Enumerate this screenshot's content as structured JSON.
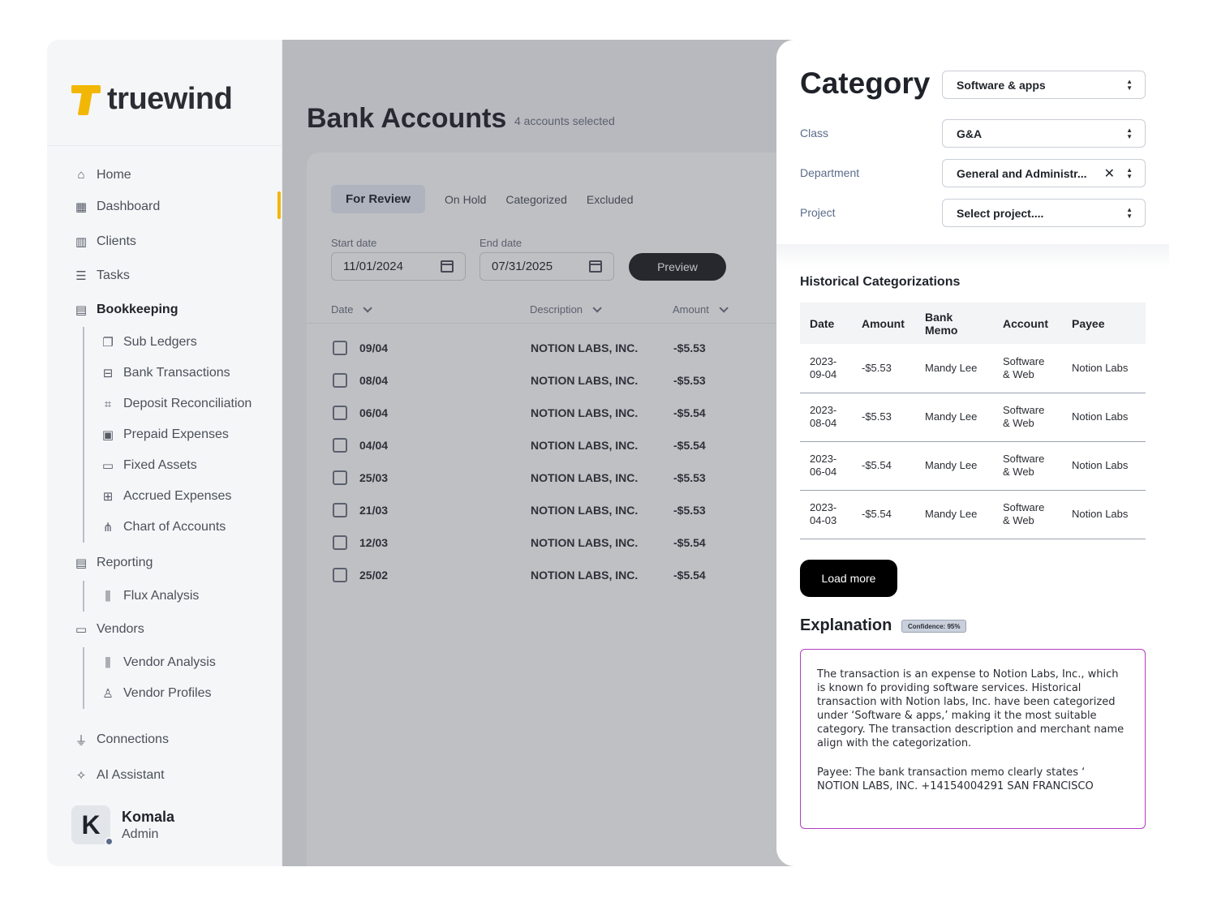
{
  "app": {
    "logo_text": "truewind",
    "brand_color": "#f2b705"
  },
  "sidebar": {
    "items": [
      {
        "label": "Home",
        "icon": "home-icon"
      },
      {
        "label": "Dashboard",
        "icon": "dashboard-icon"
      },
      {
        "label": "Clients",
        "icon": "building-icon"
      },
      {
        "label": "Tasks",
        "icon": "checklist-icon"
      },
      {
        "label": "Bookkeeping",
        "icon": "book-icon"
      },
      {
        "label": "Sub Ledgers",
        "icon": "copy-icon"
      },
      {
        "label": "Bank Transactions",
        "icon": "bank-icon"
      },
      {
        "label": "Deposit Reconciliation",
        "icon": "scan-icon"
      },
      {
        "label": "Prepaid Expenses",
        "icon": "clipboard-icon"
      },
      {
        "label": "Fixed Assets",
        "icon": "laptop-icon"
      },
      {
        "label": "Accrued Expenses",
        "icon": "plus-doc-icon"
      },
      {
        "label": "Chart of Accounts",
        "icon": "hierarchy-icon"
      },
      {
        "label": "Reporting",
        "icon": "report-icon"
      },
      {
        "label": "Flux Analysis",
        "icon": "bar-chart-icon"
      },
      {
        "label": "Vendors",
        "icon": "card-icon"
      },
      {
        "label": "Vendor Analysis",
        "icon": "bar-chart-icon"
      },
      {
        "label": "Vendor Profiles",
        "icon": "person-icon"
      },
      {
        "label": "Connections",
        "icon": "plug-icon"
      },
      {
        "label": "AI Assistant",
        "icon": "sparkle-icon"
      }
    ],
    "user": {
      "initial": "K",
      "name": "Komala",
      "role": "Admin"
    }
  },
  "main": {
    "title": "Bank Accounts",
    "subtitle": "4 accounts selected",
    "tabs": [
      "For Review",
      "On Hold",
      "Categorized",
      "Excluded"
    ],
    "start_date_label": "Start date",
    "start_date": "11/01/2024",
    "end_date_label": "End date",
    "end_date": "07/31/2025",
    "preview_label": "Preview",
    "columns": [
      "Date",
      "Description",
      "Amount"
    ],
    "rows": [
      {
        "date": "09/04",
        "description": "NOTION LABS, INC.",
        "amount": "-$5.53"
      },
      {
        "date": "08/04",
        "description": "NOTION LABS, INC.",
        "amount": "-$5.53"
      },
      {
        "date": "06/04",
        "description": "NOTION LABS, INC.",
        "amount": "-$5.54"
      },
      {
        "date": "04/04",
        "description": "NOTION LABS, INC.",
        "amount": "-$5.54"
      },
      {
        "date": "25/03",
        "description": "NOTION LABS, INC.",
        "amount": "-$5.53"
      },
      {
        "date": "21/03",
        "description": "NOTION LABS, INC.",
        "amount": "-$5.53"
      },
      {
        "date": "12/03",
        "description": "NOTION LABS, INC.",
        "amount": "-$5.54"
      },
      {
        "date": "25/02",
        "description": "NOTION LABS, INC.",
        "amount": "-$5.54"
      }
    ]
  },
  "panel": {
    "category_title": "Category",
    "category_value": "Software & apps",
    "class_label": "Class",
    "class_value": "G&A",
    "department_label": "Department",
    "department_value": "General and Administr...",
    "project_label": "Project",
    "project_placeholder": "Select project....",
    "history_title": "Historical Categorizations",
    "history_columns": [
      "Date",
      "Amount",
      "Bank Memo",
      "Account",
      "Payee"
    ],
    "history_rows": [
      {
        "date": "2023-09-04",
        "amount": "-$5.53",
        "memo": "Mandy Lee",
        "account": "Software & Web",
        "payee": "Notion Labs"
      },
      {
        "date": "2023-08-04",
        "amount": "-$5.53",
        "memo": "Mandy Lee",
        "account": "Software & Web",
        "payee": "Notion Labs"
      },
      {
        "date": "2023-06-04",
        "amount": "-$5.54",
        "memo": "Mandy Lee",
        "account": "Software & Web",
        "payee": "Notion Labs"
      },
      {
        "date": "2023-04-03",
        "amount": "-$5.54",
        "memo": "Mandy Lee",
        "account": "Software & Web",
        "payee": "Notion Labs"
      }
    ],
    "load_more_label": "Load more",
    "explanation_title": "Explanation",
    "confidence_badge": "Confidence: 95%",
    "explanation_p1": "The transaction is an expense to Notion Labs, Inc., which is known fo providing software services. Historical transaction with Notion labs, Inc. have been categorized under ‘Software & apps,’ making it the most suitable category. The transaction description and merchant name align with the categorization.",
    "explanation_p2": "Payee: The bank transaction memo clearly states ‘ NOTION LABS, INC. +14154004291 SAN FRANCISCO"
  }
}
